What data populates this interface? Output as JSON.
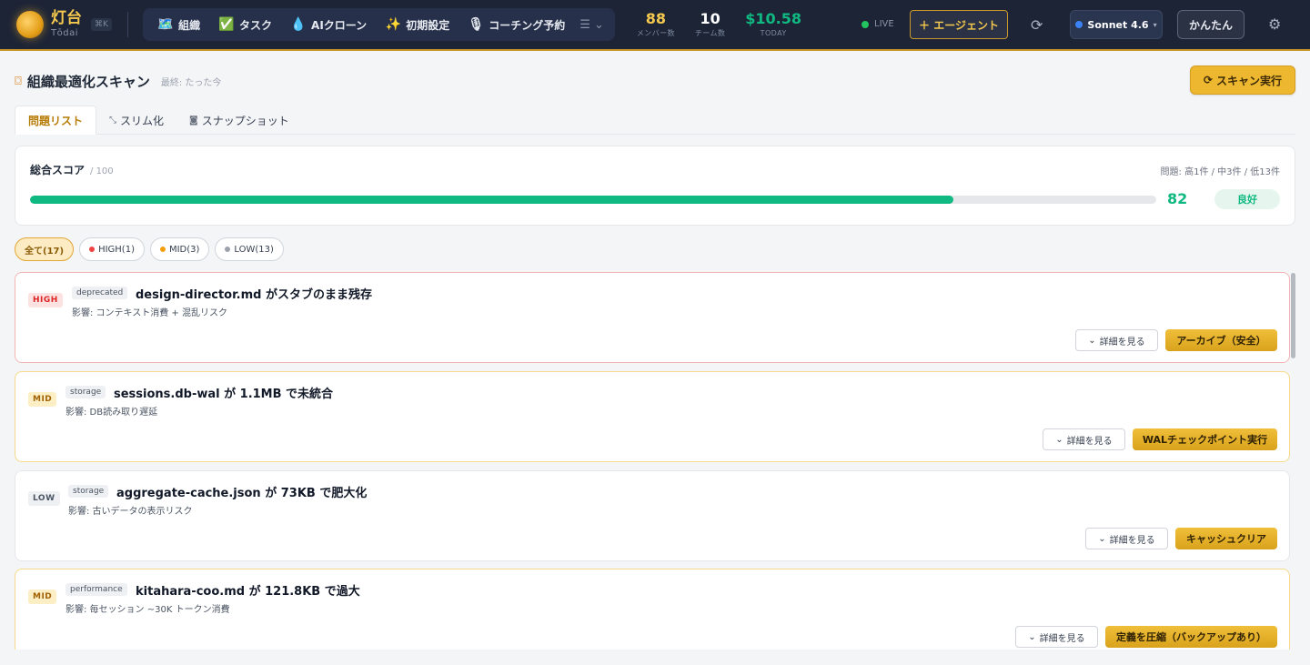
{
  "brand": {
    "name_jp": "灯台",
    "name_en": "Tōdai",
    "shortcut": "⌘K"
  },
  "nav": [
    {
      "icon": "🗺️",
      "label": "組織"
    },
    {
      "icon": "✅",
      "label": "タスク"
    },
    {
      "icon": "💧",
      "label": "AIクローン"
    },
    {
      "icon": "✨",
      "label": "初期設定"
    },
    {
      "icon": "🎙",
      "label": "コーチング予約"
    }
  ],
  "stats": {
    "members": {
      "value": "88",
      "label": "メンバー数",
      "color": "#f5c94d"
    },
    "teams": {
      "value": "10",
      "label": "チーム数",
      "color": "#ffffff"
    },
    "today": {
      "value": "$10.58",
      "label": "TODAY",
      "color": "#10b981"
    }
  },
  "header": {
    "live_label": "LIVE",
    "agent_label": "＋ エージェント",
    "model_label": "Sonnet 4.6",
    "easy_label": "かんたん"
  },
  "page": {
    "title": "組織最適化スキャン",
    "last_scan": "最終: たった今",
    "run_label": "スキャン実行"
  },
  "tabs": [
    {
      "label": "問題リスト"
    },
    {
      "label": "スリム化"
    },
    {
      "label": "スナップショット"
    }
  ],
  "score": {
    "label": "総合スコア",
    "max": "/ 100",
    "issues_summary": "問題: 高1件 / 中3件 / 低13件",
    "value": "82",
    "percent": 82,
    "grade": "良好"
  },
  "filters": [
    {
      "label": "全て(17)",
      "dot": ""
    },
    {
      "label": "HIGH(1)",
      "dot": "#ef4444"
    },
    {
      "label": "MID(3)",
      "dot": "#f59e0b"
    },
    {
      "label": "LOW(13)",
      "dot": "#9ca3af"
    }
  ],
  "detail_label": "詳細を見る",
  "issues": [
    {
      "severity": "HIGH",
      "category": "deprecated",
      "title": "design-director.md がスタブのまま残存",
      "impact": "影響: コンテキスト消費 + 混乱リスク",
      "action": "アーカイブ（安全）"
    },
    {
      "severity": "MID",
      "category": "storage",
      "title": "sessions.db-wal が 1.1MB で未統合",
      "impact": "影響: DB読み取り遅延",
      "action": "WALチェックポイント実行"
    },
    {
      "severity": "LOW",
      "category": "storage",
      "title": "aggregate-cache.json が 73KB で肥大化",
      "impact": "影響: 古いデータの表示リスク",
      "action": "キャッシュクリア"
    },
    {
      "severity": "MID",
      "category": "performance",
      "title": "kitahara-coo.md が 121.8KB で過大",
      "impact": "影響: 毎セッション ~30K トークン消費",
      "action": "定義を圧縮（バックアップあり）"
    }
  ]
}
